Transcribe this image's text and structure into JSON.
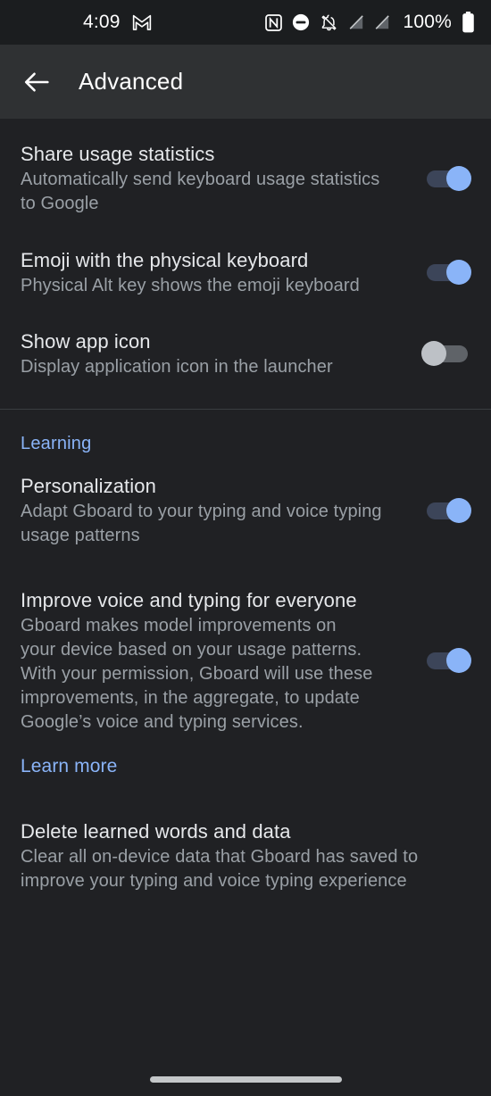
{
  "status_bar": {
    "time": "4:09",
    "battery_percent": "100%",
    "icons": [
      {
        "name": "gmail-icon"
      },
      {
        "name": "nfc-icon"
      },
      {
        "name": "do-not-disturb-icon"
      },
      {
        "name": "notifications-muted-icon"
      },
      {
        "name": "no-signal-icon"
      },
      {
        "name": "no-sim-icon"
      },
      {
        "name": "battery-full-icon"
      }
    ]
  },
  "toolbar": {
    "title": "Advanced",
    "back_icon": "back-arrow-icon"
  },
  "preferences": [
    {
      "key": "share_usage_statistics",
      "title": "Share usage statistics",
      "summary": "Automatically send keyboard usage statistics\nto Google",
      "switch_state": "on"
    },
    {
      "key": "emoji_physical_keyboard",
      "title": "Emoji with the physical keyboard",
      "summary": "Physical Alt key shows the emoji keyboard",
      "switch_state": "on"
    },
    {
      "key": "show_app_icon",
      "title": "Show app icon",
      "summary": "Display application icon in the launcher",
      "switch_state": "off"
    }
  ],
  "learning_section": {
    "category_title": "Learning",
    "preferences": [
      {
        "key": "personalization",
        "title": "Personalization",
        "summary": "Adapt Gboard to your typing and voice typing\nusage patterns",
        "switch_state": "on"
      },
      {
        "key": "improve_voice_and_typing",
        "title": "Improve voice and typing for everyone",
        "summary": "Gboard makes model improvements on\nyour device based on your usage patterns.\nWith your permission, Gboard will use these\nimprovements, in the aggregate, to update\nGoogle’s voice and typing services.",
        "switch_state": "on"
      }
    ],
    "learn_more_label": "Learn more",
    "delete_learned": {
      "key": "delete_learned_words_and_data",
      "title": "Delete learned words and data",
      "summary": "Clear all on-device data that Gboard has saved to\nimprove your typing and voice typing experience"
    }
  },
  "navigation_bar": {
    "gesture_pill": "home-gesture-pill"
  },
  "colors": {
    "background": "#202124",
    "toolbar_background": "#2f3133",
    "status_bar_background": "#1b1d1f",
    "accent_blue": "#8ab4f8",
    "switch_on_track": "#3c4559",
    "switch_off_track": "#5f6368",
    "switch_off_thumb": "#bdc1c6",
    "title_text": "#e6e8eb",
    "summary_text": "#9aa0a6",
    "divider": "#3a3d40"
  }
}
